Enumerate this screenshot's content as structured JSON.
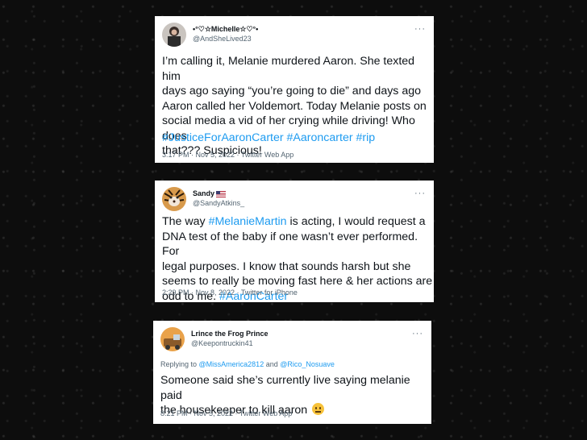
{
  "tweets": [
    {
      "name": "•°♡☆Michelle☆♡°•",
      "handle": "@AndSheLived23",
      "more_icon": "more-horizontal-icon",
      "lines": [
        "I’m calling it, Melanie murdered Aaron. She texted him",
        "days ago saying “you’re going to die” and days ago",
        "Aaron called her Voldemort. Today Melanie posts on",
        "social media a vid of her crying while driving! Who does",
        "that??? Suspicious!"
      ],
      "hashtags": "#JusticeForAaronCarter #Aaroncarter #rip",
      "meta": "3:17 PM · Nov 5, 2022 · Twitter Web App"
    },
    {
      "name": "Sandy",
      "flag_icon": "us-flag-icon",
      "handle": "@SandyAtkins_",
      "line1_pre": "The way ",
      "line1_tag": "#MelanieMartin",
      "line1_post": " is acting, I would request a",
      "lines": [
        "DNA test of the baby if one wasn’t ever performed. For",
        "legal purposes. I know that sounds harsh but she",
        "seems to really be moving fast here & her actions are"
      ],
      "line5_pre": "odd to me. ",
      "line5_tag": "#AaronCarter",
      "meta": "2:29 PM · Nov 8, 2022 · Twitter for iPhone"
    },
    {
      "name": "Lrince the Frog Prince",
      "handle": "@Keepontruckin41",
      "reply_prefix": "Replying to ",
      "reply_user1": "@MissAmerica2812",
      "reply_and": " and ",
      "reply_user2": "@Rico_Nosuave",
      "lines": [
        "Someone said she’s currently live saying melanie paid",
        "the housekeeper to kill aaron"
      ],
      "emoji": "neutral-face-emoji",
      "meta": "8:21 PM · Nov 5, 2022 · Twitter Web App"
    }
  ],
  "colors": {
    "link": "#1d9bf0",
    "text": "#0f1419",
    "muted": "#536471",
    "background": "#0d0d0d"
  }
}
